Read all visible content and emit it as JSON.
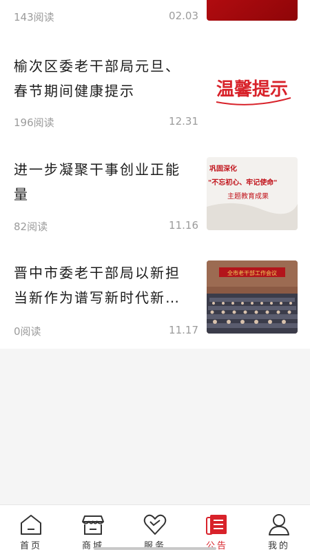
{
  "news_list": [
    {
      "title": "",
      "reads": "143阅读",
      "date": "02.03",
      "thumb": "red-banner-image"
    },
    {
      "title": "榆次区委老干部局元旦、春节期间健康提示",
      "reads": "196阅读",
      "date": "12.31",
      "thumb": "warm-reminder-image",
      "thumb_text": "温馨提示"
    },
    {
      "title": "进一步凝聚干事创业正能量",
      "reads": "82阅读",
      "date": "11.16",
      "thumb": "theme-education-image",
      "thumb_lines": [
        "巩固深化",
        "\"不忘初心、牢记使命\"",
        "主题教育成果"
      ]
    },
    {
      "title": "晋中市委老干部局以新担当新作为谱写新时代新…",
      "reads": "0阅读",
      "date": "11.17",
      "thumb": "conference-photo",
      "thumb_banner": "全市老干部工作会议"
    }
  ],
  "tabbar": [
    {
      "label": "首页",
      "icon": "home-icon",
      "active": false
    },
    {
      "label": "商城",
      "icon": "shop-icon",
      "active": false
    },
    {
      "label": "服务",
      "icon": "heart-icon",
      "active": false
    },
    {
      "label": "公告",
      "icon": "notice-icon",
      "active": true
    },
    {
      "label": "我的",
      "icon": "user-icon",
      "active": false
    }
  ],
  "colors": {
    "accent": "#d8222a",
    "text": "#1c1c1c",
    "meta": "#9b9b9b",
    "background": "#f5f5f5"
  }
}
